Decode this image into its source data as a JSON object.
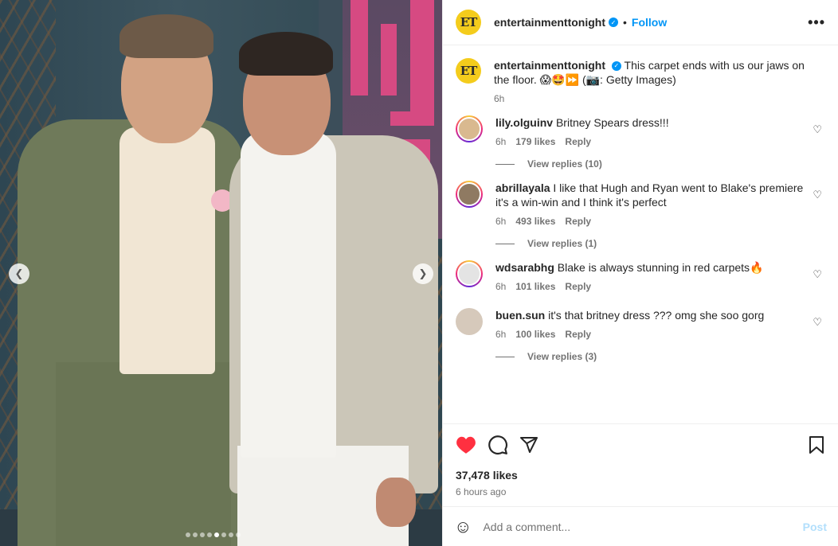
{
  "header": {
    "logo_text": "ET",
    "username": "entertainmenttonight",
    "separator": "•",
    "follow_label": "Follow",
    "more_icon": "ellipsis-icon"
  },
  "caption": {
    "username": "entertainmenttonight",
    "text_line1": "This carpet ends with us our jaws on",
    "text_line2": "the floor. 😱🤩⏩ (📷: Getty Images)",
    "time": "6h"
  },
  "comments": [
    {
      "username": "lily.olguinv",
      "text": "Britney Spears dress!!!",
      "time": "6h",
      "likes": "179 likes",
      "reply": "Reply",
      "view_replies": "View replies (10)"
    },
    {
      "username": "abrillayala",
      "text_line1": "I like that Hugh and Ryan went to Blake's premiere",
      "text_line2": "it's a win-win and I think it's perfect",
      "time": "6h",
      "likes": "493 likes",
      "reply": "Reply",
      "view_replies": "View replies (1)"
    },
    {
      "username": "wdsarabhg",
      "text": "Blake is always stunning in red carpets🔥",
      "time": "6h",
      "likes": "101 likes",
      "reply": "Reply"
    },
    {
      "username": "buen.sun",
      "text": "it's that britney dress ??? omg she soo gorg",
      "time": "6h",
      "likes": "100 likes",
      "reply": "Reply",
      "view_replies": "View replies (3)"
    }
  ],
  "actions": {
    "like_icon": "heart-filled-icon",
    "comment_icon": "comment-icon",
    "share_icon": "share-icon",
    "save_icon": "bookmark-icon",
    "likes_count": "37,478 likes",
    "time_ago": "6 hours ago",
    "like_color": "#ff3040"
  },
  "add_comment": {
    "placeholder": "Add a comment...",
    "post_label": "Post",
    "emoji_icon": "smiley-icon"
  },
  "media": {
    "carousel_dots": 8,
    "active_dot": 4
  }
}
